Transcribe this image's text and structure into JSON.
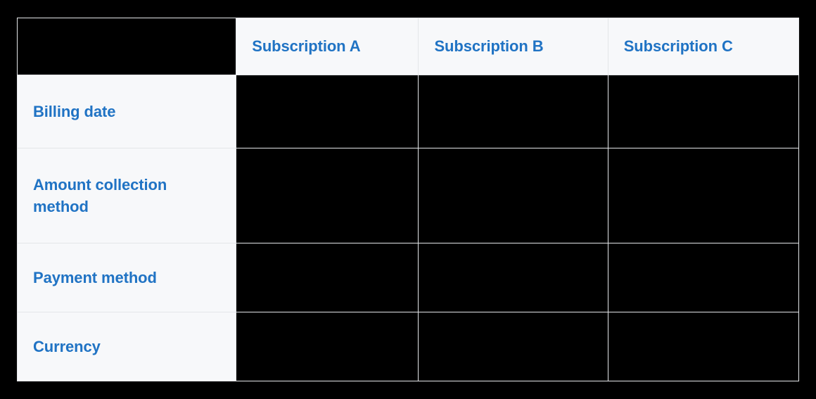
{
  "page": {
    "background_color": "#000000",
    "surface_color": "#f7f8fa",
    "border_color": "#e4e6e9",
    "accent_color": "#2073c4",
    "redaction_color": "#000000"
  },
  "table": {
    "name": "subscription-comparison-table",
    "corner_header": {
      "label": "",
      "redacted": true
    },
    "column_headers": [
      {
        "label": "Subscription A",
        "redacted": false
      },
      {
        "label": "Subscription B",
        "redacted": false
      },
      {
        "label": "Subscription C",
        "redacted": false
      }
    ],
    "rows": [
      {
        "label": "Billing date",
        "cells": [
          {
            "value": "",
            "redacted": true
          },
          {
            "value": "",
            "redacted": true
          },
          {
            "value": "",
            "redacted": true
          }
        ]
      },
      {
        "label": "Amount collection method",
        "cells": [
          {
            "value": "",
            "redacted": true
          },
          {
            "value": "",
            "redacted": true
          },
          {
            "value": "",
            "redacted": true
          }
        ]
      },
      {
        "label": "Payment method",
        "cells": [
          {
            "value": "",
            "redacted": true
          },
          {
            "value": "",
            "redacted": true
          },
          {
            "value": "",
            "redacted": true
          }
        ]
      },
      {
        "label": "Currency",
        "cells": [
          {
            "value": "",
            "redacted": true
          },
          {
            "value": "",
            "redacted": true
          },
          {
            "value": "",
            "redacted": true
          }
        ]
      }
    ]
  }
}
